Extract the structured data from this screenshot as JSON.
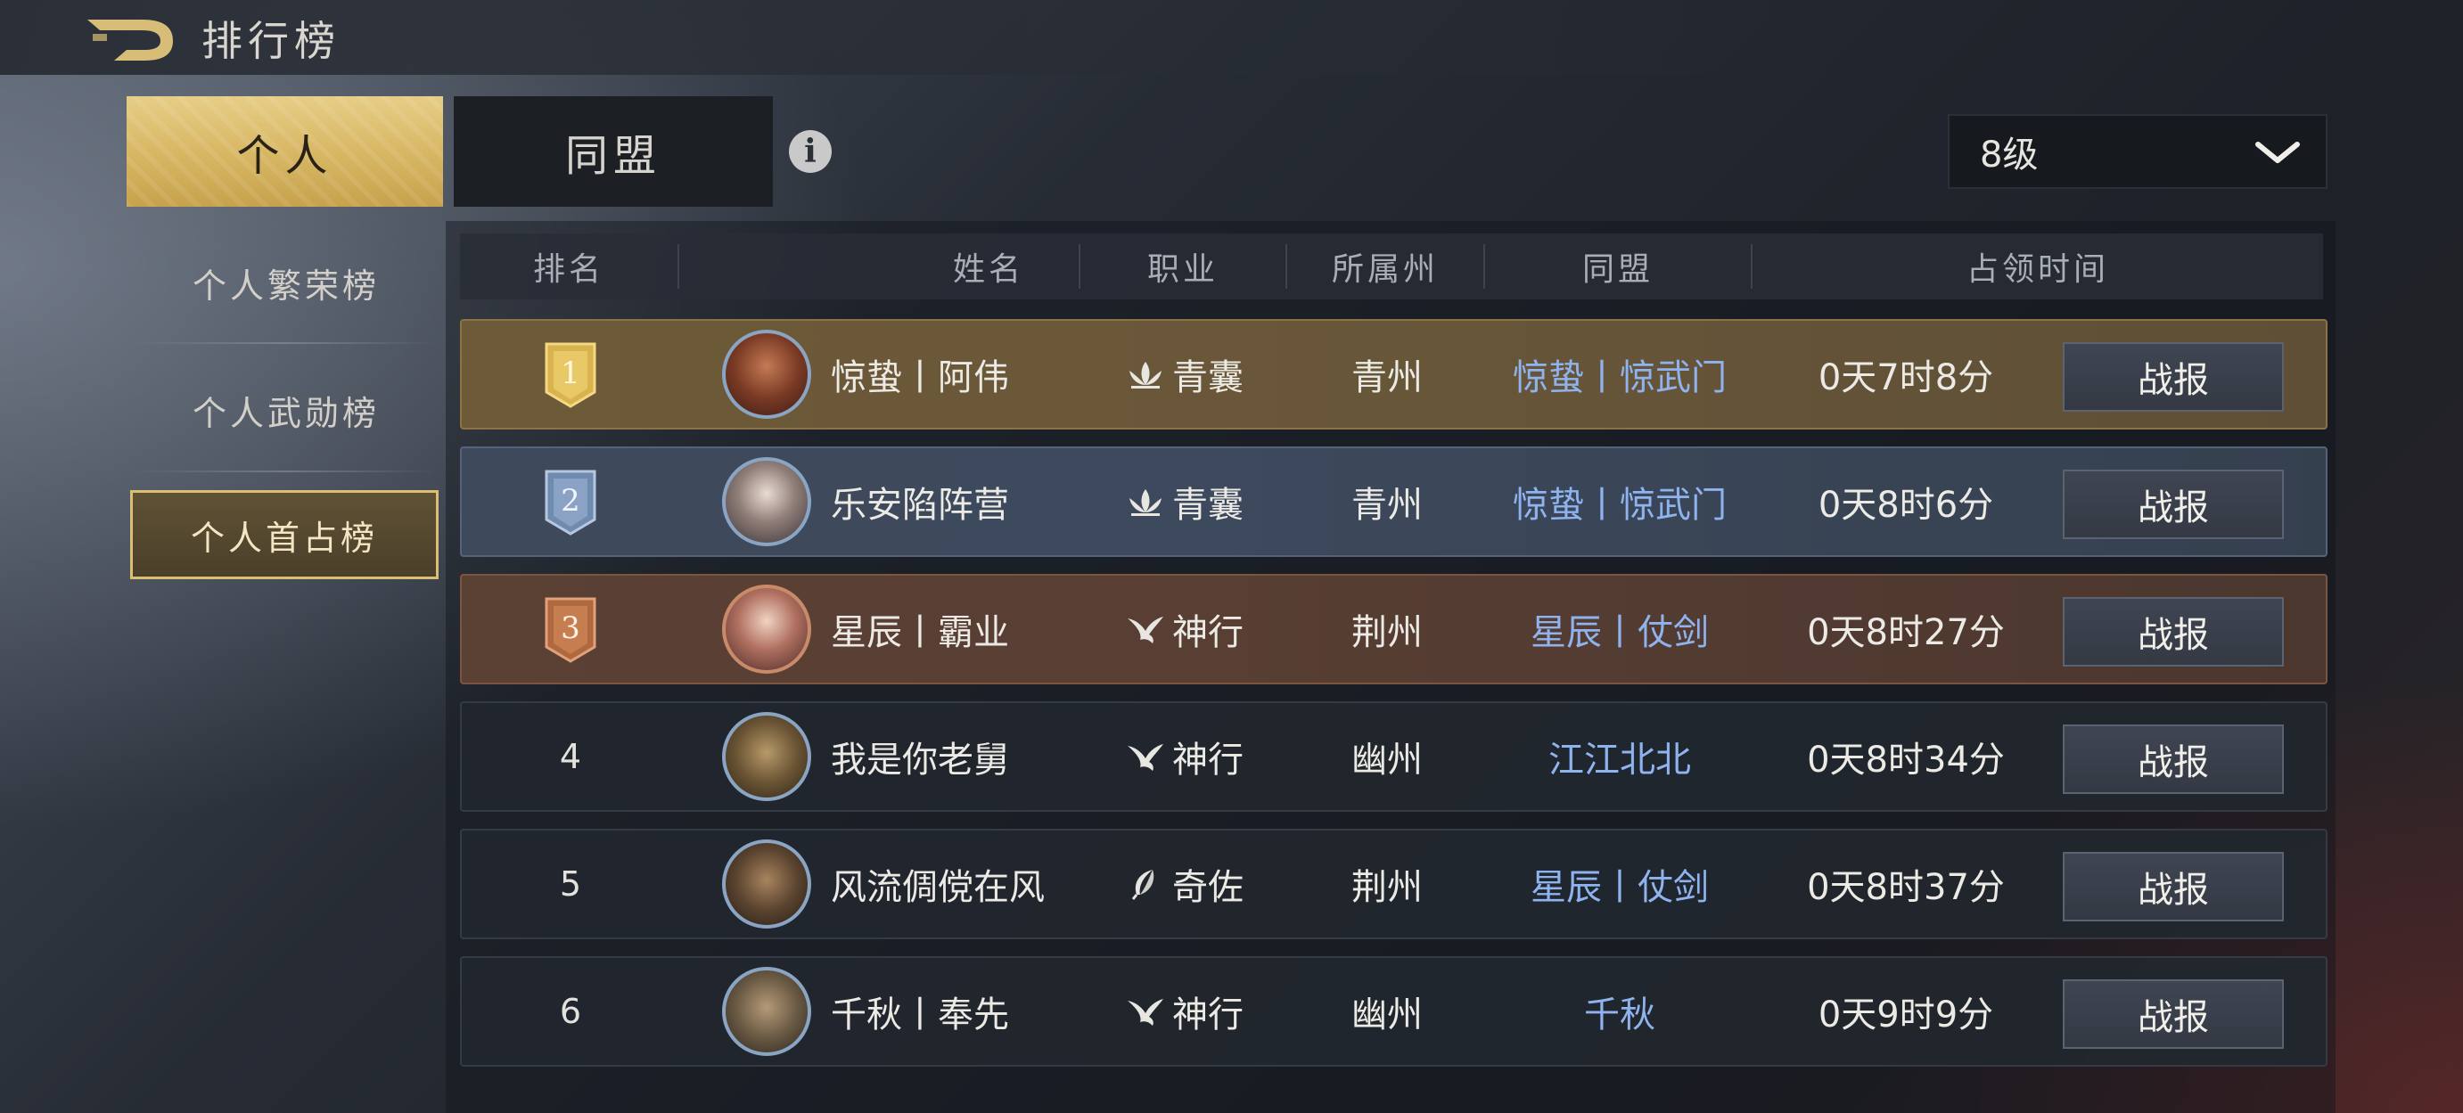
{
  "header": {
    "title": "排行榜",
    "back_icon": "back-arrow-icon"
  },
  "tabs": [
    {
      "label": "个人",
      "active": true
    },
    {
      "label": "同盟",
      "active": false
    }
  ],
  "info_icon": "i",
  "level_select": {
    "value": "8级"
  },
  "sidebar": {
    "items": [
      {
        "label": "个人繁荣榜",
        "active": false
      },
      {
        "label": "个人武勋榜",
        "active": false
      },
      {
        "label": "个人首占榜",
        "active": true
      }
    ]
  },
  "table": {
    "columns": [
      "排名",
      "姓名",
      "职业",
      "所属州",
      "同盟",
      "占领时间"
    ],
    "rows": [
      {
        "rank": "1",
        "name": "惊蛰丨阿伟",
        "profession": "青囊",
        "profession_icon": "lotus-icon",
        "state": "青州",
        "alliance": "惊蛰丨惊武门",
        "time": "0天7时8分",
        "action": "战报"
      },
      {
        "rank": "2",
        "name": "乐安陷阵营",
        "profession": "青囊",
        "profession_icon": "lotus-icon",
        "state": "青州",
        "alliance": "惊蛰丨惊武门",
        "time": "0天8时6分",
        "action": "战报"
      },
      {
        "rank": "3",
        "name": "星辰丨霸业",
        "profession": "神行",
        "profession_icon": "eagle-icon",
        "state": "荆州",
        "alliance": "星辰丨仗剑",
        "time": "0天8时27分",
        "action": "战报"
      },
      {
        "rank": "4",
        "name": "我是你老舅",
        "profession": "神行",
        "profession_icon": "eagle-icon",
        "state": "幽州",
        "alliance": "江江北北",
        "time": "0天8时34分",
        "action": "战报"
      },
      {
        "rank": "5",
        "name": "风流倜傥在风",
        "profession": "奇佐",
        "profession_icon": "feather-icon",
        "state": "荆州",
        "alliance": "星辰丨仗剑",
        "time": "0天8时37分",
        "action": "战报"
      },
      {
        "rank": "6",
        "name": "千秋丨奉先",
        "profession": "神行",
        "profession_icon": "eagle-icon",
        "state": "幽州",
        "alliance": "千秋",
        "time": "0天9时9分",
        "action": "战报"
      }
    ]
  },
  "colors": {
    "gold_tab": "#d8b865",
    "alliance_text": "#8fb3ee",
    "rank1_bg": "#6d5a38",
    "rank2_bg": "#3e4a5c",
    "rank3_bg": "#5b4034"
  }
}
